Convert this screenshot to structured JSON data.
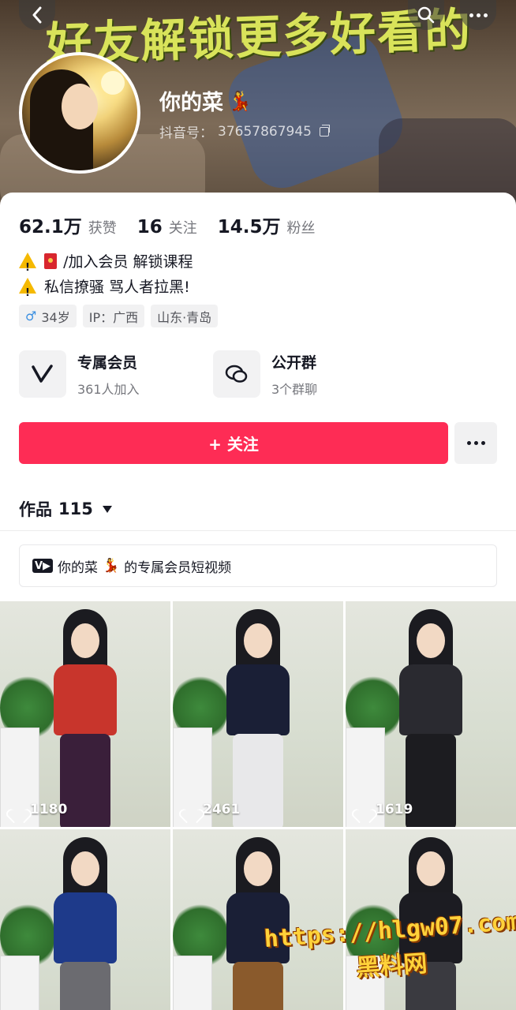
{
  "header": {
    "banner_text": "好友解锁更多好看的",
    "username": "你的菜",
    "username_emoji": "💃",
    "douyin_id_label": "抖音号：",
    "douyin_id": "37657867945"
  },
  "stats": [
    {
      "num": "62.1万",
      "label": "获赞"
    },
    {
      "num": "16",
      "label": "关注"
    },
    {
      "num": "14.5万",
      "label": "粉丝"
    }
  ],
  "bio": {
    "line1": "/加入会员  解锁课程",
    "line2": "私信撩骚 骂人者拉黑!"
  },
  "tags": {
    "age": "34岁",
    "ip": "IP：广西",
    "location": "山东·青岛",
    "gender_symbol": "♂"
  },
  "features": [
    {
      "title": "专属会员",
      "sub": "361人加入",
      "icon": "v-logo-icon"
    },
    {
      "title": "公开群",
      "sub": "3个群聊",
      "icon": "chat-bubbles-icon"
    }
  ],
  "actions": {
    "follow_label": "+ 关注"
  },
  "works": {
    "label": "作品",
    "count": "115"
  },
  "member_bar": {
    "name": "你的菜",
    "emoji": "💃",
    "suffix": "的专属会员短视频"
  },
  "videos": [
    {
      "likes": "1180",
      "top_color": "#c8352c",
      "bottom_color": "#3a1f3a"
    },
    {
      "likes": "2461",
      "top_color": "#1a1f36",
      "bottom_color": "#e8e8ea"
    },
    {
      "likes": "1619",
      "top_color": "#2a2a30",
      "bottom_color": "#1c1c20"
    },
    {
      "likes": "",
      "top_color": "#1e3a8a",
      "bottom_color": "#6b6b70"
    },
    {
      "likes": "",
      "top_color": "#1a1f36",
      "bottom_color": "#8a5a2c"
    },
    {
      "likes": "",
      "top_color": "#1c1c22",
      "bottom_color": "#3a3a40"
    }
  ],
  "watermark": {
    "url": "https://hlgw07.com",
    "text": "黑料网"
  },
  "colors": {
    "accent": "#fe2c55",
    "banner_text": "#d9e35a"
  }
}
